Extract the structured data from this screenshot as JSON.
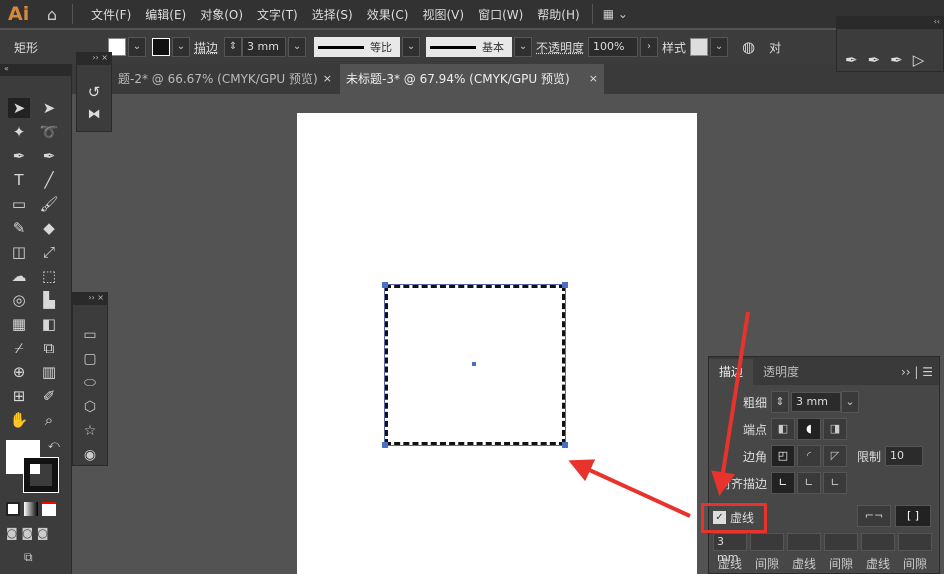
{
  "app": {
    "logo": "Ai",
    "home_icon": "home-icon"
  },
  "menu": [
    "文件(F)",
    "编辑(E)",
    "对象(O)",
    "文字(T)",
    "选择(S)",
    "效果(C)",
    "视图(V)",
    "窗口(W)",
    "帮助(H)"
  ],
  "control": {
    "object_type": "矩形",
    "stroke_label": "描边",
    "stroke_weight": "3 mm",
    "profile": "等比",
    "brush": "基本",
    "opacity_label": "不透明度",
    "opacity": "100%",
    "style_label": "样式",
    "align_label": "对"
  },
  "tabs": [
    {
      "label": "题-2* @ 66.67% (CMYK/GPU 预览)",
      "close": "×"
    },
    {
      "label": "未标题-3* @ 67.94% (CMYK/GPU 预览)",
      "close": "×"
    }
  ],
  "stroke_panel": {
    "tabs": [
      "描边",
      "透明度"
    ],
    "weight_label": "粗细",
    "weight": "3 mm",
    "cap_label": "端点",
    "corner_label": "边角",
    "limit_label": "限制",
    "limit": "10",
    "align_label": "对齐描边",
    "dashed_label": "虚线",
    "dashed_checked": true,
    "dash_fields": [
      {
        "label": "虚线",
        "value": "3 mm"
      },
      {
        "label": "间隙",
        "value": ""
      },
      {
        "label": "虚线",
        "value": ""
      },
      {
        "label": "间隙",
        "value": ""
      },
      {
        "label": "虚线",
        "value": ""
      },
      {
        "label": "间隙",
        "value": ""
      }
    ]
  },
  "colors": {
    "accent_red": "#e8322c",
    "handle": "#4a6fc7",
    "app_bg": "#535353"
  }
}
